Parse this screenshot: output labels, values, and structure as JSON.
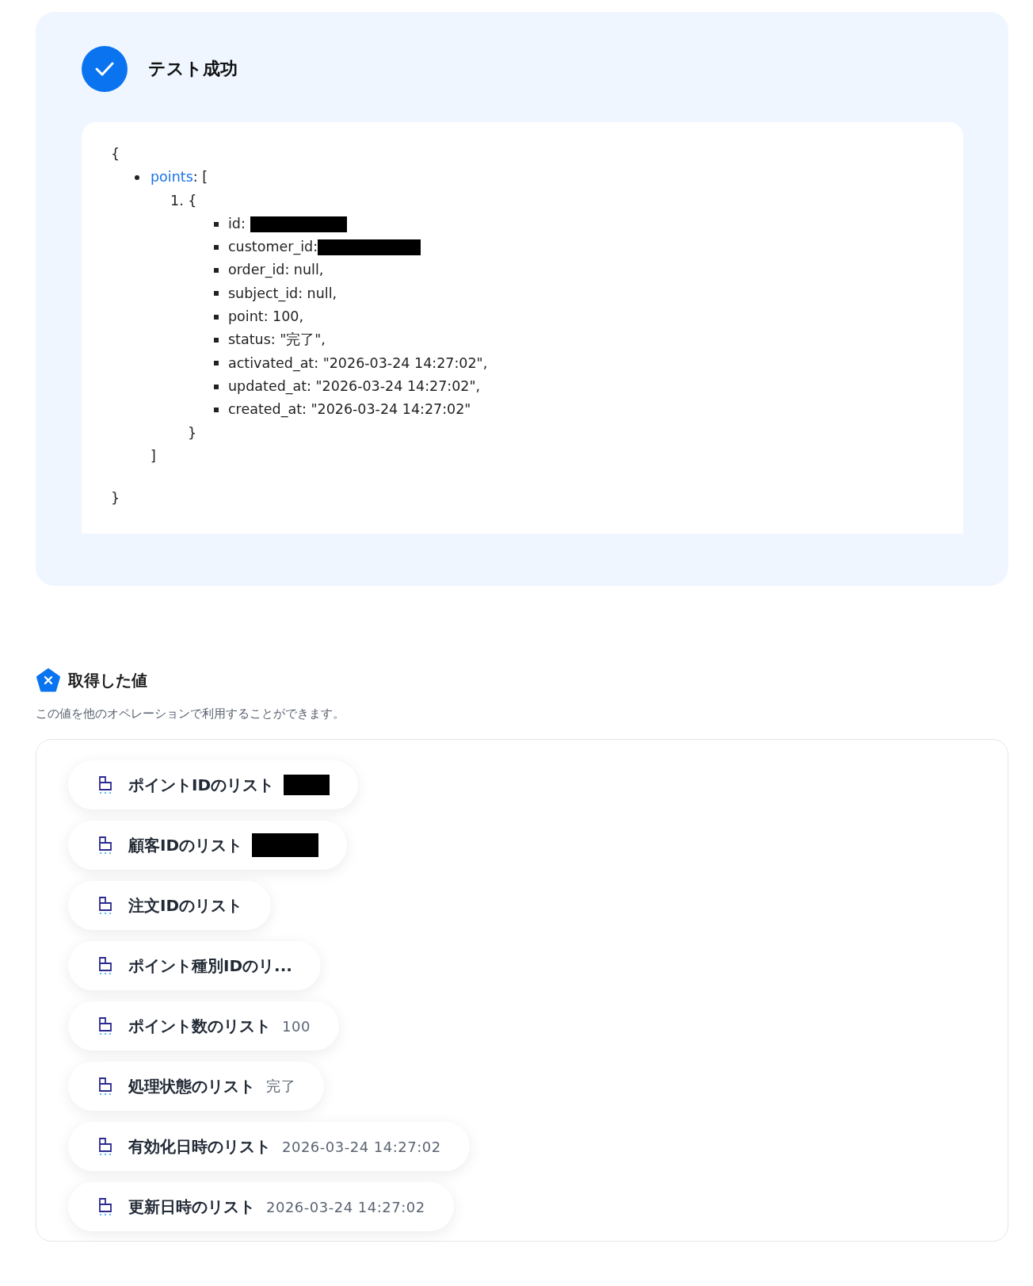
{
  "result": {
    "title": "テスト成功",
    "output": {
      "open": "{",
      "key": "points",
      "key_suffix": ": [",
      "item_index": "1.",
      "item_open": "{",
      "fields": [
        {
          "text": "id:",
          "redacted": true
        },
        {
          "text": "customer_id:",
          "redacted": true
        },
        {
          "text": "order_id: null,",
          "redacted": false
        },
        {
          "text": "subject_id: null,",
          "redacted": false
        },
        {
          "text": "point: 100,",
          "redacted": false
        },
        {
          "text": "status: \"完了\",",
          "redacted": false
        },
        {
          "text": "activated_at: \"2026-03-24 14:27:02\",",
          "redacted": false
        },
        {
          "text": "updated_at: \"2026-03-24 14:27:02\",",
          "redacted": false
        },
        {
          "text": "created_at: \"2026-03-24 14:27:02\"",
          "redacted": false
        }
      ],
      "item_close": "}",
      "list_close": "]",
      "close": "}"
    }
  },
  "values": {
    "title": "取得した値",
    "description": "この値を他のオペレーションで利用することができます。",
    "items": [
      {
        "label": "ポイントIDのリスト",
        "redacted": true
      },
      {
        "label": "顧客IDのリスト",
        "redacted": true
      },
      {
        "label": "注文IDのリスト",
        "redacted": false
      },
      {
        "label": "ポイント種別IDのリ...",
        "redacted": false
      },
      {
        "label": "ポイント数のリスト",
        "value": "100",
        "redacted": false
      },
      {
        "label": "処理状態のリスト",
        "value": "完了",
        "redacted": false
      },
      {
        "label": "有効化日時のリスト",
        "value": "2026-03-24 14:27:02",
        "redacted": false
      },
      {
        "label": "更新日時のリスト",
        "value": "2026-03-24 14:27:02",
        "redacted": false
      }
    ]
  }
}
